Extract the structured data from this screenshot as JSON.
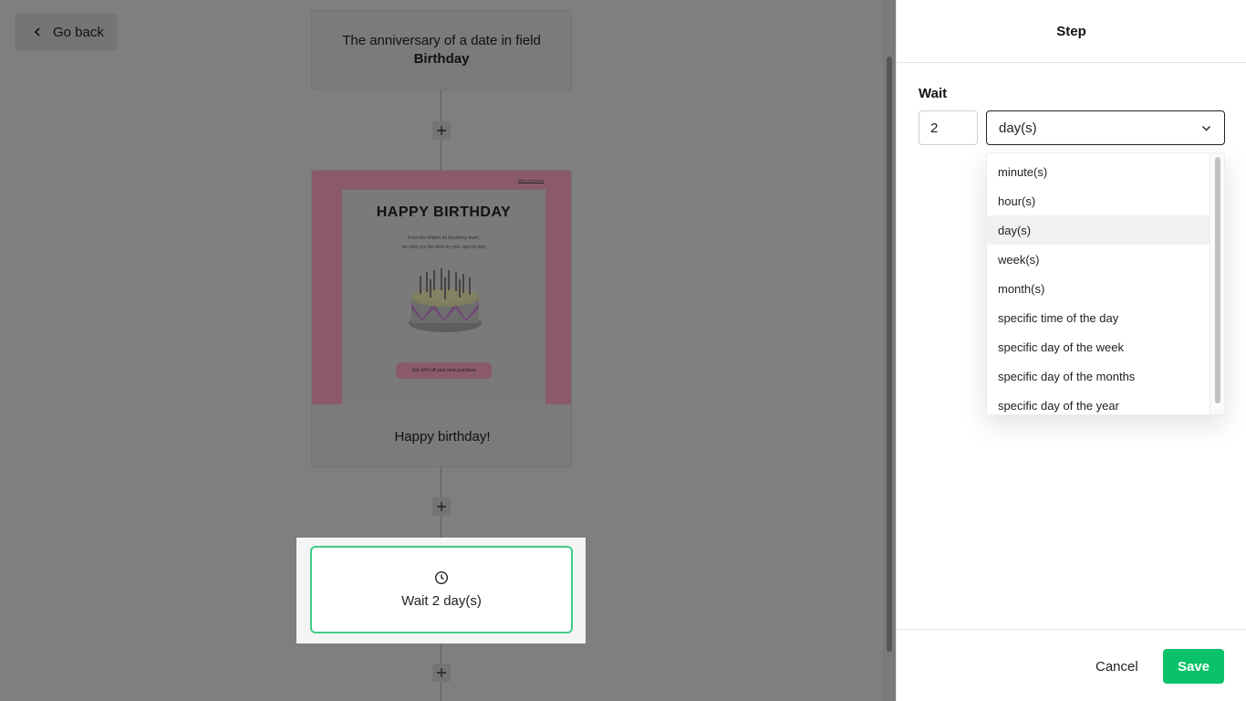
{
  "canvas": {
    "go_back_label": "Go back",
    "trigger": {
      "text_prefix": "The anniversary of a date in field",
      "field_name": "Birthday"
    },
    "email": {
      "preview_title": "HAPPY BIRTHDAY",
      "preview_sub_1": "From the MailerLite Academy team,",
      "preview_sub_2": "we wish you the best on your special day!",
      "preview_browser_link": "View in browser",
      "preview_cta": "Get 10% off your next purchase",
      "name": "Happy birthday!"
    },
    "wait_step": {
      "label": "Wait 2 day(s)"
    }
  },
  "panel": {
    "title": "Step",
    "wait_label": "Wait",
    "wait_value": "2",
    "unit_selected": "day(s)",
    "unit_options": [
      "minute(s)",
      "hour(s)",
      "day(s)",
      "week(s)",
      "month(s)",
      "specific time of the day",
      "specific day of the week",
      "specific day of the months",
      "specific day of the year"
    ],
    "cancel_label": "Cancel",
    "save_label": "Save"
  },
  "colors": {
    "accent_green": "#09c269",
    "selected_border": "#3fcb86",
    "email_brand": "#8a5a6c"
  }
}
